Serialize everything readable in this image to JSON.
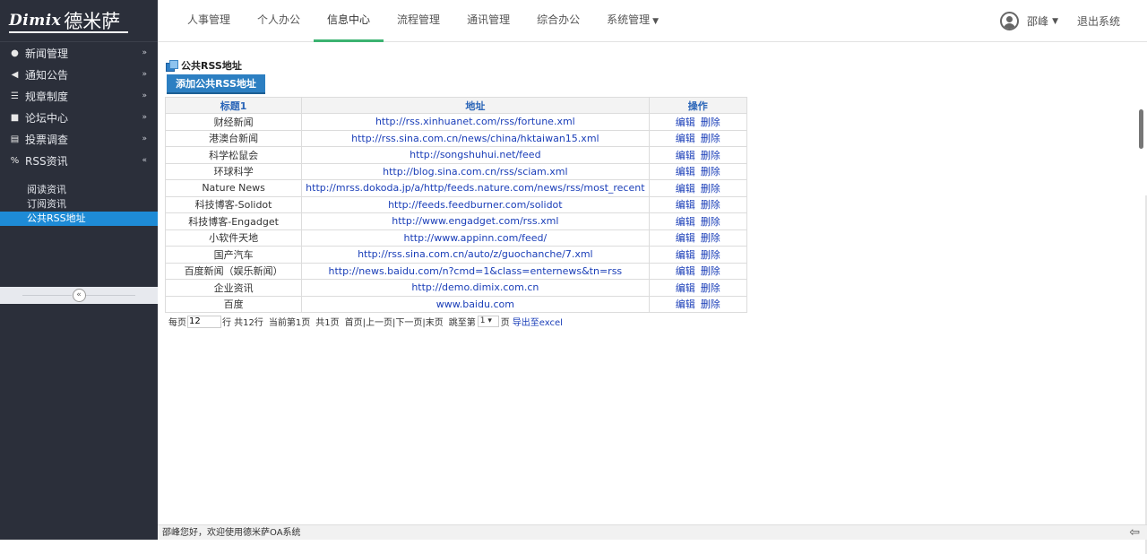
{
  "logo": {
    "brand_latin": "Dimix",
    "brand_cn": "德米萨"
  },
  "sidebar": {
    "menu": [
      {
        "icon": "globe-icon",
        "glyph": "●",
        "label": "新闻管理",
        "chev": "»"
      },
      {
        "icon": "megaphone-icon",
        "glyph": "◀",
        "label": "通知公告",
        "chev": "»"
      },
      {
        "icon": "list-icon",
        "glyph": "☰",
        "label": "规章制度",
        "chev": "»"
      },
      {
        "icon": "comment-icon",
        "glyph": "■",
        "label": "论坛中心",
        "chev": "»"
      },
      {
        "icon": "ballot-icon",
        "glyph": "▤",
        "label": "投票调查",
        "chev": "»"
      },
      {
        "icon": "rss-icon",
        "glyph": "%",
        "label": "RSS资讯",
        "chev": "«"
      }
    ],
    "submenu": [
      "阅读资讯",
      "订阅资讯",
      "公共RSS地址"
    ],
    "collapse_glyph": "«"
  },
  "topnav": {
    "tabs": [
      "人事管理",
      "个人办公",
      "信息中心",
      "流程管理",
      "通讯管理",
      "综合办公",
      "系统管理"
    ],
    "active_tab": "信息中心",
    "dropdown_caret": "▼"
  },
  "user": {
    "name": "邵峰",
    "caret": "▼",
    "logout": "退出系统"
  },
  "page": {
    "title": "公共RSS地址",
    "add_button": "添加公共RSS地址",
    "columns": [
      "标题1",
      "地址",
      "操作"
    ],
    "edit_label": "编辑",
    "delete_label": "删除",
    "rows": [
      {
        "title": "财经新闻",
        "url": "http://rss.xinhuanet.com/rss/fortune.xml"
      },
      {
        "title": "港澳台新闻",
        "url": "http://rss.sina.com.cn/news/china/hktaiwan15.xml"
      },
      {
        "title": "科学松鼠会",
        "url": "http://songshuhui.net/feed"
      },
      {
        "title": "环球科学",
        "url": "http://blog.sina.com.cn/rss/sciam.xml"
      },
      {
        "title": "Nature News",
        "url": "http://mrss.dokoda.jp/a/http/feeds.nature.com/news/rss/most_recent"
      },
      {
        "title": "科技博客-Solidot",
        "url": "http://feeds.feedburner.com/solidot"
      },
      {
        "title": "科技博客-Engadget",
        "url": "http://www.engadget.com/rss.xml"
      },
      {
        "title": "小软件天地",
        "url": "http://www.appinn.com/feed/"
      },
      {
        "title": "国产汽车",
        "url": "http://rss.sina.com.cn/auto/z/guochanche/7.xml"
      },
      {
        "title": "百度新闻（娱乐新闻）",
        "url": "http://news.baidu.com/n?cmd=1&class=enternews&tn=rss"
      },
      {
        "title": "企业资讯",
        "url": "http://demo.dimix.com.cn"
      },
      {
        "title": "百度",
        "url": "www.baidu.com"
      }
    ]
  },
  "pager": {
    "per_page_label": "每页",
    "per_page_value": "12",
    "rows_label": "行 共12行",
    "current_page": "当前第1页",
    "total_pages": "共1页",
    "nav": "首页|上一页|下一页|末页",
    "jump_label": "跳至第",
    "jump_value": "1 ▾",
    "page_suffix": "页",
    "export": "导出至excel"
  },
  "status": {
    "message": "邵峰您好，欢迎使用德米萨OA系统",
    "icon_glyph": "⇦"
  },
  "colors": {
    "sidebar": "#2b2f3a",
    "accent": "#1e8bd6",
    "active_tab": "#3cb371",
    "button": "#2c7fc2",
    "link": "#1a3eb8"
  }
}
